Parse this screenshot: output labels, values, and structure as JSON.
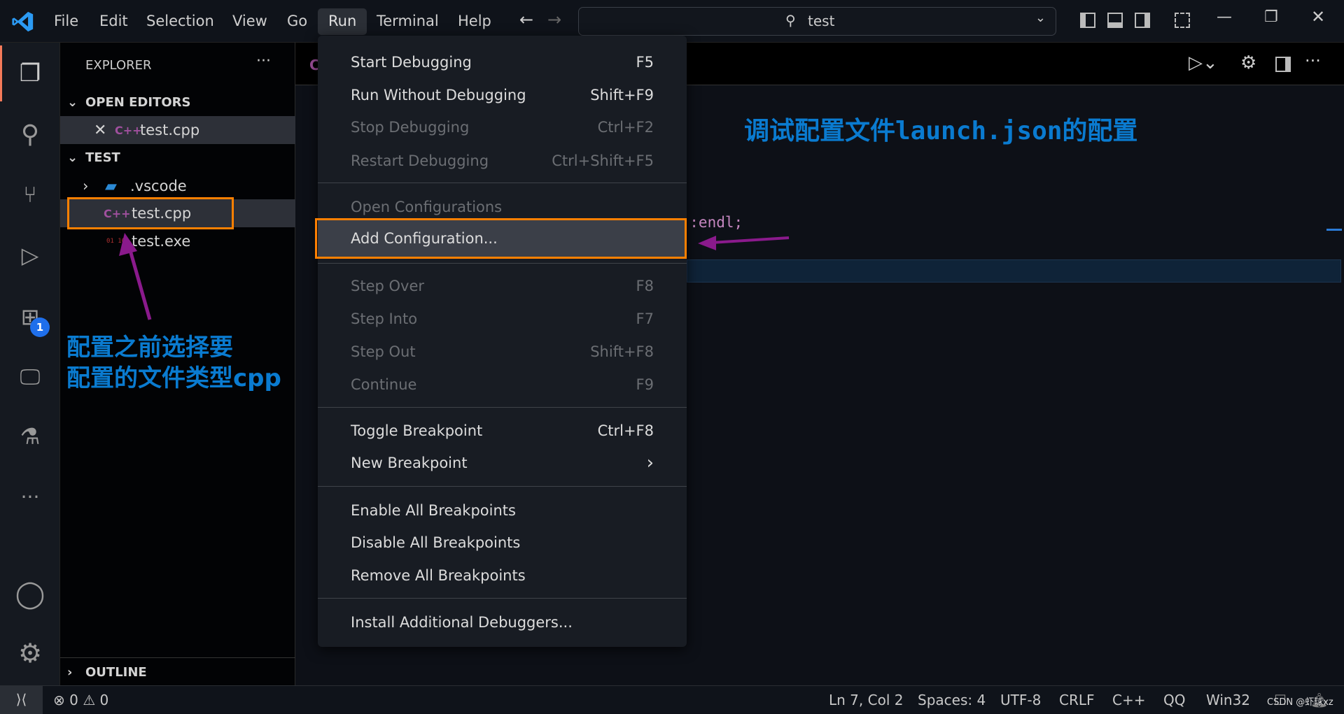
{
  "titlebar": {
    "menus": [
      "File",
      "Edit",
      "Selection",
      "View",
      "Go",
      "Run",
      "Terminal",
      "Help"
    ],
    "search": "test"
  },
  "sidebar": {
    "title": "EXPLORER",
    "open_editors": "OPEN EDITORS",
    "open_file": "test.cpp",
    "folder": "TEST",
    "items": [
      ".vscode",
      "test.cpp",
      "test.exe"
    ],
    "outline": "OUTLINE",
    "cpp_icon": "C++",
    "exe_icon": "01 10"
  },
  "activity": {
    "extensions_badge": "1"
  },
  "editor": {
    "tab_partial": "C",
    "code": "d::endl;",
    "annotation": "调试配置文件launch.json的配置"
  },
  "sidebar_annotation": {
    "line1": "配置之前选择要",
    "line2": "配置的文件类型cpp"
  },
  "run_menu": {
    "items": [
      {
        "label": "Start Debugging",
        "key": "F5"
      },
      {
        "label": "Run Without Debugging",
        "key": "Shift+F9"
      },
      {
        "label": "Stop Debugging",
        "key": "Ctrl+F2"
      },
      {
        "label": "Restart Debugging",
        "key": "Ctrl+Shift+F5"
      },
      {
        "label": "Open Configurations",
        "key": ""
      },
      {
        "label": "Add Configuration...",
        "key": ""
      },
      {
        "label": "Step Over",
        "key": "F8"
      },
      {
        "label": "Step Into",
        "key": "F7"
      },
      {
        "label": "Step Out",
        "key": "Shift+F8"
      },
      {
        "label": "Continue",
        "key": "F9"
      },
      {
        "label": "Toggle Breakpoint",
        "key": "Ctrl+F8"
      },
      {
        "label": "New Breakpoint",
        "key": "›"
      },
      {
        "label": "Enable All Breakpoints",
        "key": ""
      },
      {
        "label": "Disable All Breakpoints",
        "key": ""
      },
      {
        "label": "Remove All Breakpoints",
        "key": ""
      },
      {
        "label": "Install Additional Debuggers...",
        "key": ""
      }
    ]
  },
  "statusbar": {
    "errors": "0",
    "warnings": "0",
    "position": "Ln 7, Col 2",
    "spaces": "Spaces: 4",
    "encoding": "UTF-8",
    "eol": "CRLF",
    "language": "C++",
    "qq": "QQ",
    "platform": "Win32",
    "watermark": "CSDN @虾球xz"
  },
  "colors": {
    "highlight_box": "#ff8000",
    "annotation": "#0a7bd0",
    "arrow": "#8a1a8c",
    "accent": "#f47a5a"
  }
}
